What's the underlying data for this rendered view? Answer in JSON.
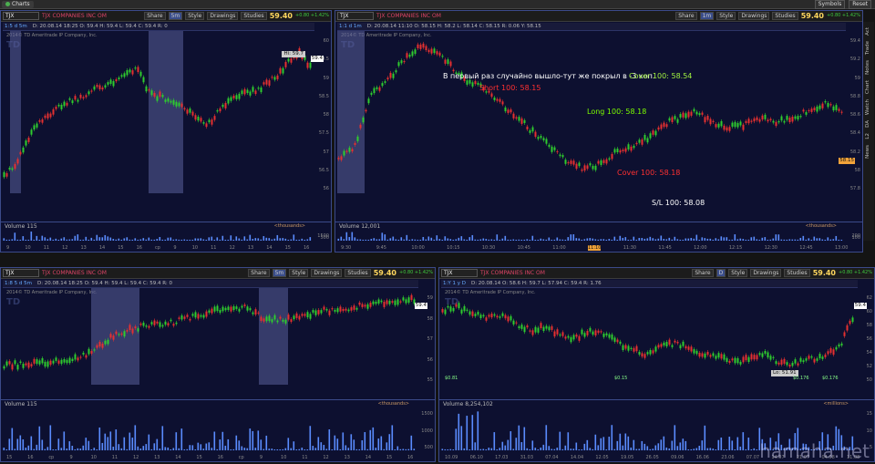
{
  "app": {
    "tab": "Charts",
    "buttons": [
      "Symbols",
      "Reset"
    ]
  },
  "panels": {
    "tl": {
      "symbol": "TJX",
      "company": "TJX COMPANIES INC OM",
      "agg": "1:5 d 5m",
      "ohlc": "D: 20.08.14 18:25   O: 59.4   H: 59.4   L: 59.4   C: 59.4   R: 0",
      "price": "59.40",
      "change": "+0.80 +1.42%",
      "copyright": "2014© TD Ameritrade IP Company, Inc.",
      "volume": "115",
      "units": "<thousands>",
      "agg_btn": "5m",
      "buttons": [
        "Share",
        "Style",
        "Drawings",
        "Studies"
      ],
      "hi": "Hi: 59.7",
      "last": "59.4",
      "yticks": [
        "60",
        "59.5",
        "59",
        "58.5",
        "58",
        "57.5",
        "57",
        "56.5",
        "56"
      ],
      "vticks": [
        "1500",
        "500"
      ],
      "xticks": [
        "9",
        "10",
        "11",
        "12",
        "13",
        "14",
        "15",
        "16",
        "cp",
        "9",
        "10",
        "11",
        "12",
        "13",
        "14",
        "15",
        "16"
      ]
    },
    "tr": {
      "symbol": "TJX",
      "company": "TJX COMPANIES INC OM",
      "agg": "1:1 d 1m",
      "ohlc": "D: 20.08.14 11:10   O: 58.15   H: 58.2   L: 58.14   C: 58.15   R: 0.06   Y: 58.15",
      "price": "59.40",
      "change": "+0.80 +1.42%",
      "copyright": "2014© TD Ameritrade IP Company, Inc.",
      "volume": "12,001",
      "units": "<thousands>",
      "agg_btn": "1m",
      "buttons": [
        "Share",
        "Style",
        "Drawings",
        "Studies"
      ],
      "last": "58.15",
      "yticks": [
        "59.4",
        "59.2",
        "59",
        "58.8",
        "58.6",
        "58.4",
        "58.2",
        "58",
        "57.8"
      ],
      "vticks": [
        "200",
        "100"
      ],
      "xticks": [
        "9:30",
        "9:45",
        "10:00",
        "10:15",
        "10:30",
        "10:45",
        "11:00",
        "11:10",
        "11:30",
        "11:45",
        "12:00",
        "12:15",
        "12:30",
        "12:45",
        "13:00"
      ],
      "annotations": {
        "note": "В первый раз случайно вышло-тут же покрыл в -3 коп.",
        "short": "Short 100: 58.15",
        "long": "Long 100: 58.18",
        "cover1": "Cover 100: 58.54",
        "cover2": "Cover 100: 58.18",
        "stop": "S/L 100: 58.08"
      }
    },
    "bl": {
      "symbol": "TJX",
      "company": "TJX COMPANIES INC OM",
      "agg": "1:8 5 d 5m",
      "ohlc": "D: 20.08.14 18:25   O: 59.4   H: 59.4   L: 59.4   C: 59.4   R: 0",
      "price": "59.40",
      "change": "+0.80 +1.42%",
      "copyright": "2014© TD Ameritrade IP Company, Inc.",
      "volume": "115",
      "units": "<thousands>",
      "agg_btn": "5m",
      "buttons": [
        "Share",
        "Style",
        "Drawings",
        "Studies"
      ],
      "last": "59.4",
      "yticks": [
        "59",
        "58",
        "57",
        "56",
        "55"
      ],
      "vticks": [
        "1500",
        "1000",
        "500"
      ],
      "xticks": [
        "15",
        "16",
        "cp",
        "9",
        "10",
        "11",
        "12",
        "13",
        "14",
        "15",
        "16",
        "cp",
        "9",
        "10",
        "11",
        "12",
        "13",
        "14",
        "15",
        "16"
      ]
    },
    "br": {
      "symbol": "TJX",
      "company": "TJX COMPANIES INC OM",
      "agg": "1:Y 1 y D",
      "ohlc": "D: 20.08.14   O: 58.6   H: 59.7   L: 57.94   C: 59.4   R: 1.76",
      "price": "59.40",
      "change": "+0.80 +1.42%",
      "copyright": "2014© TD Ameritrade IP Company, Inc.",
      "volume": "8,254,102",
      "units": "<millions>",
      "agg_btn": "D",
      "buttons": [
        "Share",
        "Style",
        "Drawings",
        "Studies"
      ],
      "last": "59.4",
      "lo": "Lo: 51.91",
      "yticks": [
        "62",
        "60",
        "58",
        "56",
        "54",
        "52",
        "50"
      ],
      "vticks": [
        "15",
        "10",
        "5"
      ],
      "xticks": [
        "10.09",
        "06.10",
        "17.03",
        "31.03",
        "07.04",
        "14.04",
        "12.05",
        "19.05",
        "26.05",
        "09.06",
        "16.06",
        "23.06",
        "07.07",
        "14.07",
        "21.07",
        "04.08",
        "11.08"
      ],
      "dividends": [
        "$0.81",
        "$0.15",
        "$0.176",
        "$0.176"
      ]
    }
  },
  "sidebar": [
    "Act",
    "Trade",
    "Notes",
    "Chart",
    "Watch",
    "DA",
    "L2",
    "News"
  ],
  "watermark": "hamaha.net"
}
